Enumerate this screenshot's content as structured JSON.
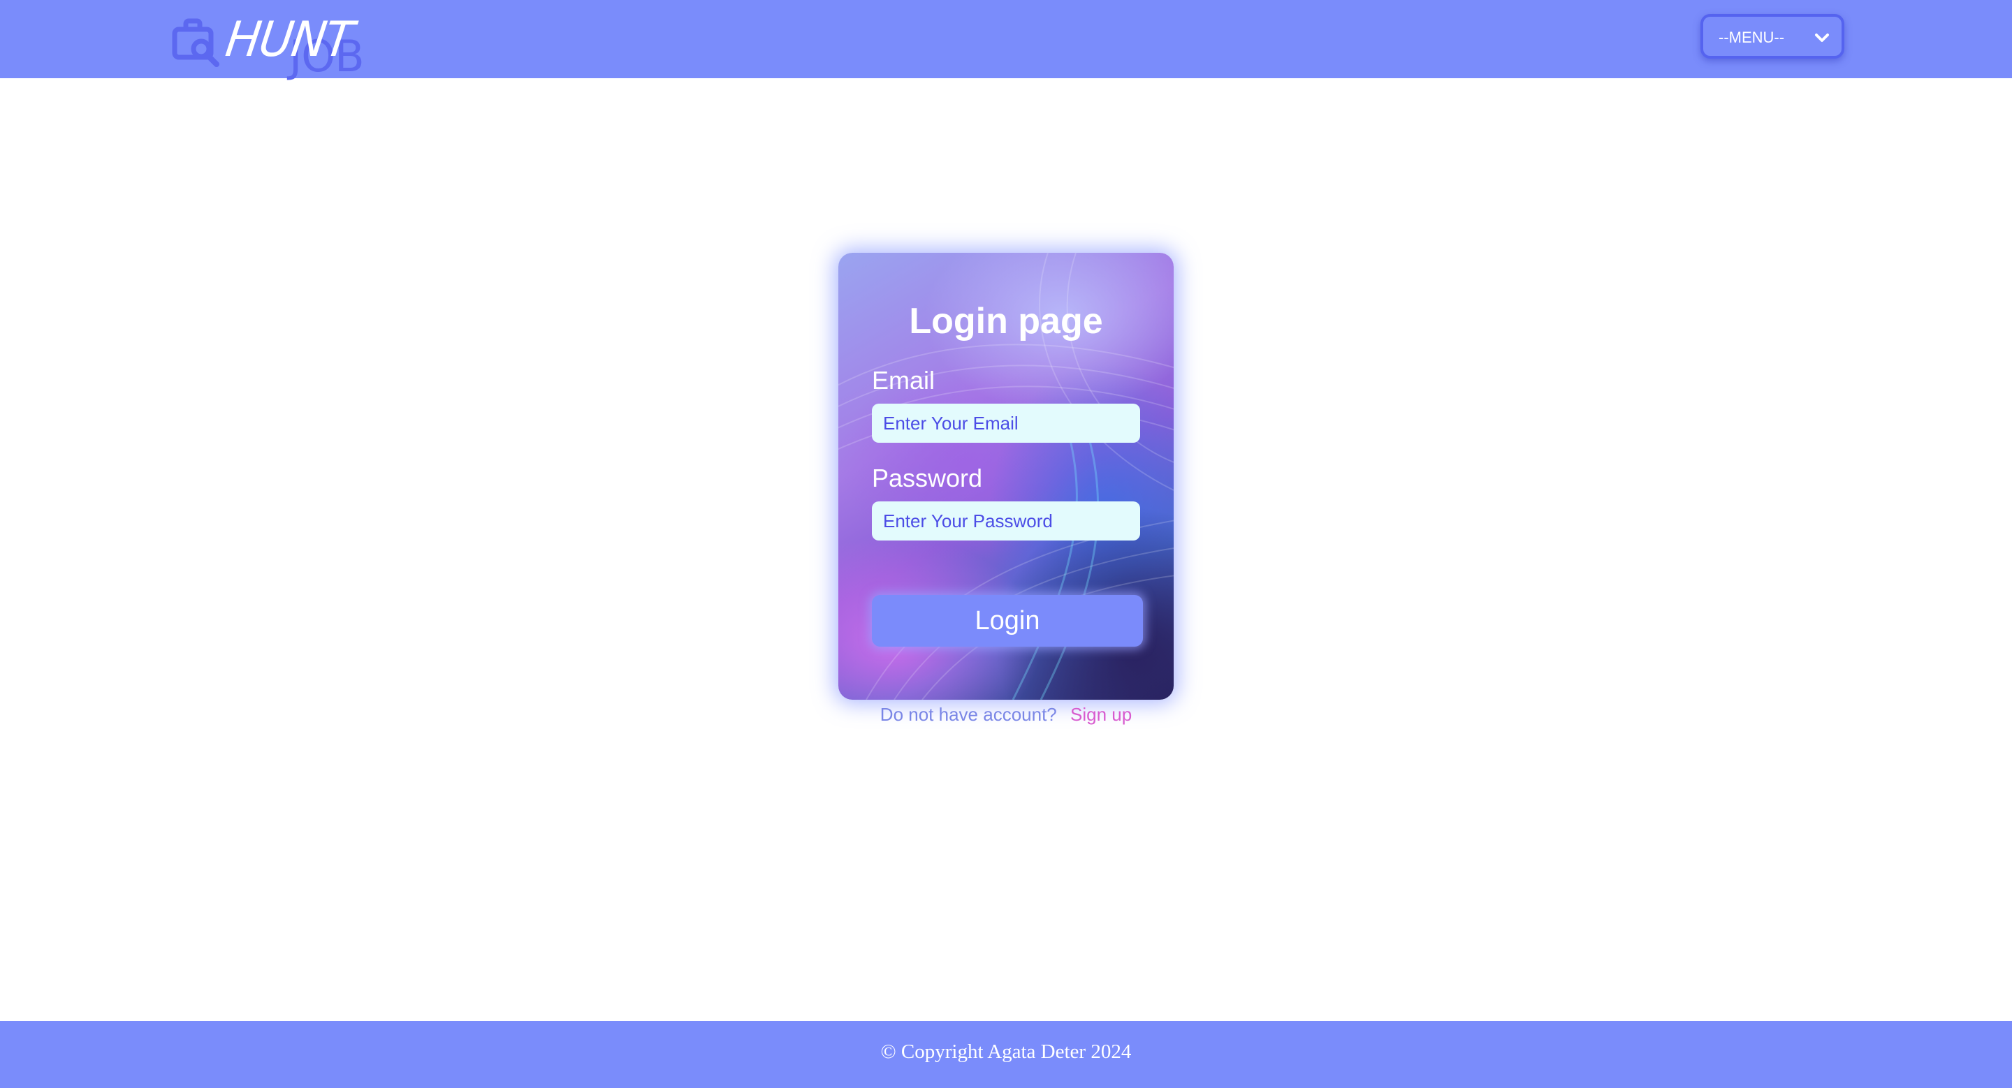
{
  "header": {
    "logo": {
      "word1": "HUNT",
      "word2": "JOB",
      "icon": "briefcase-search-icon"
    },
    "menu": {
      "selected": "--MENU--",
      "icon": "chevron-down-icon"
    }
  },
  "login_card": {
    "title": "Login page",
    "email": {
      "label": "Email",
      "placeholder": "Enter Your Email"
    },
    "password": {
      "label": "Password",
      "placeholder": "Enter Your Password"
    },
    "submit_label": "Login"
  },
  "signup": {
    "prompt": "Do not have account?",
    "link_label": "Sign up"
  },
  "footer": {
    "copyright": "© Copyright Agata Deter 2024"
  },
  "colors": {
    "header_bg": "#7a8cfb",
    "accent": "#5c68f0",
    "signup_link": "#d85bcf",
    "input_bg": "#e3fbfd"
  }
}
